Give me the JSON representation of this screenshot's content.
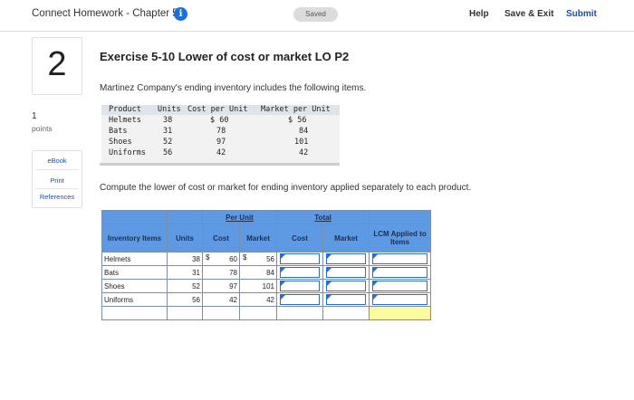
{
  "header": {
    "title": "Connect Homework - Chapter 5",
    "info_icon": "i",
    "saved": "Saved",
    "help": "Help",
    "save_exit": "Save & Exit",
    "submit": "Submit"
  },
  "question": {
    "number": "2",
    "points_value": "1",
    "points_label": "points"
  },
  "sidebar": {
    "ebook": "eBook",
    "print": "Print",
    "references": "References"
  },
  "exercise": {
    "title": "Exercise 5-10 Lower of cost or market LO P2",
    "intro": "Martinez Company's ending inventory includes the following items.",
    "instructions": "Compute the lower of cost or market for ending inventory applied separately to each product."
  },
  "given_table": {
    "headers": [
      "Product",
      "Units",
      "Cost per Unit",
      "Market per Unit"
    ],
    "rows": [
      {
        "product": "Helmets",
        "units": "38",
        "cost": "$ 60",
        "market": "$ 56"
      },
      {
        "product": "Bats",
        "units": "31",
        "cost": "78",
        "market": "84"
      },
      {
        "product": "Shoes",
        "units": "52",
        "cost": "97",
        "market": "101"
      },
      {
        "product": "Uniforms",
        "units": "56",
        "cost": "42",
        "market": "42"
      }
    ]
  },
  "worksheet": {
    "group_per_unit": "Per Unit",
    "group_total": "Total",
    "col_items": "Inventory Items",
    "col_units": "Units",
    "col_cost": "Cost",
    "col_market": "Market",
    "col_total_cost": "Cost",
    "col_total_market": "Market",
    "col_lcm": "LCM Applied to Items",
    "currency": "$",
    "rows": [
      {
        "item": "Helmets",
        "units": "38",
        "cost": "60",
        "market": "56"
      },
      {
        "item": "Bats",
        "units": "31",
        "cost": "78",
        "market": "84"
      },
      {
        "item": "Shoes",
        "units": "52",
        "cost": "97",
        "market": "101"
      },
      {
        "item": "Uniforms",
        "units": "56",
        "cost": "42",
        "market": "42"
      }
    ]
  },
  "colors": {
    "header_blue": "#5e9ae4",
    "input_border": "#2a6cd6",
    "answer_yellow": "#fdfba0",
    "link_blue": "#1a4e9e"
  }
}
